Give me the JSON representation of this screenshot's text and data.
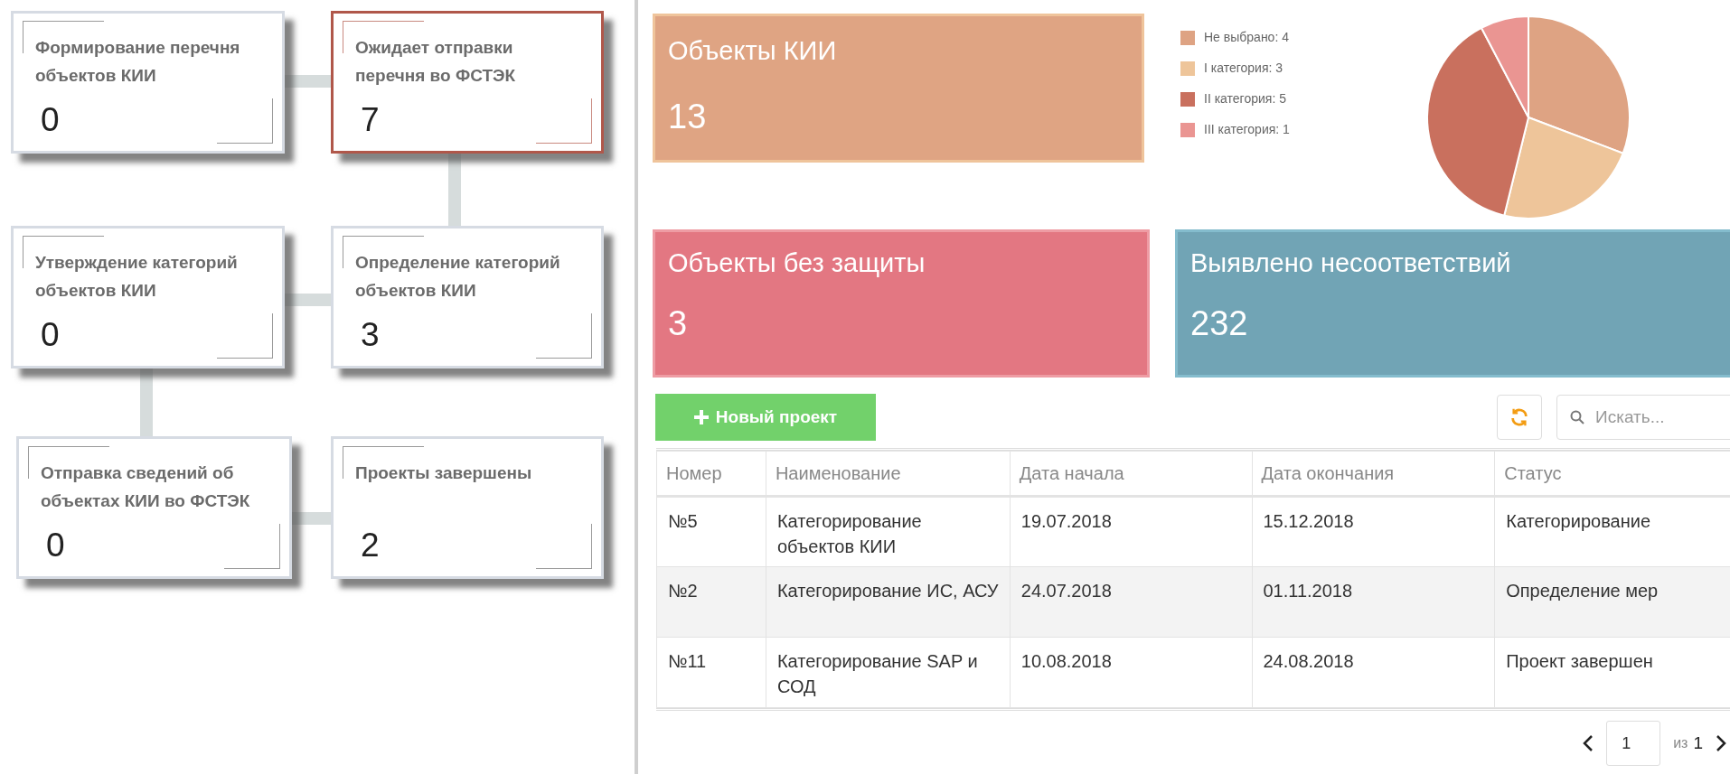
{
  "stages": [
    {
      "title": "Формирование перечня объектов КИИ",
      "count": "0",
      "selected": false
    },
    {
      "title": "Ожидает отправки перечня во ФСТЭК",
      "count": "7",
      "selected": true
    },
    {
      "title": "Утверждение категорий объектов КИИ",
      "count": "0",
      "selected": false
    },
    {
      "title": "Определение категорий объектов КИИ",
      "count": "3",
      "selected": false
    },
    {
      "title": "Отправка сведений об объектах КИИ во ФСТЭК",
      "count": "0",
      "selected": false
    },
    {
      "title": "Проекты завершены",
      "count": "2",
      "selected": false
    }
  ],
  "objects_card": {
    "title": "Объекты КИИ",
    "value": "13",
    "color": "#dfa483"
  },
  "category_chart": {
    "legend": [
      {
        "color": "#dea383"
      },
      {
        "color": "#eec59a"
      },
      {
        "color": "#c9705e"
      },
      {
        "color": "#ea9592"
      }
    ],
    "chart_data": {
      "type": "pie",
      "categories": [
        "Не выбрано: 4",
        "I категория: 3",
        "II категория: 5",
        "III категория: 1"
      ],
      "values": [
        4,
        3,
        5,
        1
      ]
    }
  },
  "stat_cards": [
    {
      "title": "Объекты без защиты",
      "value": "3",
      "color": "#e37782"
    },
    {
      "title": "Выявлено несоответствий",
      "value": "232",
      "color": "#71a4b5"
    }
  ],
  "toolbar": {
    "new_button": "Новый проект",
    "search": {
      "placeholder": "Искать..."
    }
  },
  "table": {
    "columns": [
      "Номер",
      "Наименование",
      "Дата начала",
      "Дата окончания",
      "Статус"
    ],
    "rows": [
      {
        "cells": [
          "№5",
          "Категорирование объектов КИИ",
          "19.07.2018",
          "15.12.2018",
          "Категорирование"
        ]
      },
      {
        "cells": [
          "№2",
          "Категорирование ИС, АСУ",
          "24.07.2018",
          "01.11.2018",
          "Определение мер"
        ]
      },
      {
        "cells": [
          "№11",
          "Категорирование SAP и СОД",
          "10.08.2018",
          "24.08.2018",
          "Проект завершен"
        ]
      }
    ]
  },
  "pagination": {
    "page": "1",
    "of_label": "из",
    "total": "1"
  }
}
